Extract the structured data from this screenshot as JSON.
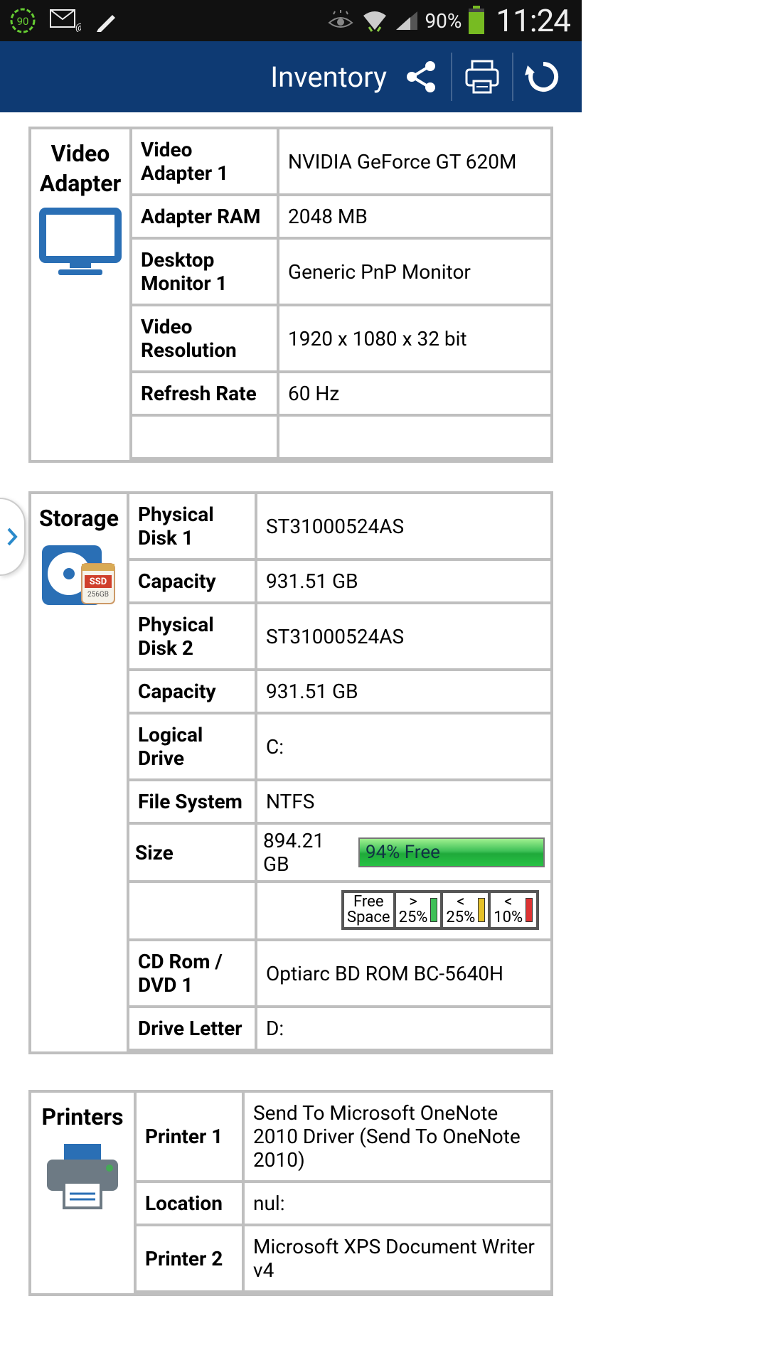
{
  "status": {
    "battery_pct": "90%",
    "time": "11:24"
  },
  "header": {
    "title": "Inventory"
  },
  "video": {
    "title": "Video Adapter",
    "rows": [
      {
        "k": "Video Adapter 1",
        "v": "NVIDIA GeForce GT 620M"
      },
      {
        "k": "Adapter RAM",
        "v": "2048 MB"
      },
      {
        "k": "Desktop Monitor 1",
        "v": "Generic PnP Monitor"
      },
      {
        "k": "Video Resolution",
        "v": "1920 x 1080 x 32 bit"
      },
      {
        "k": "Refresh Rate",
        "v": "60 Hz"
      }
    ]
  },
  "storage": {
    "title": "Storage",
    "rows_top": [
      {
        "k": "Physical Disk 1",
        "v": "ST31000524AS"
      },
      {
        "k": "Capacity",
        "v": "931.51 GB"
      },
      {
        "k": "Physical Disk 2",
        "v": "ST31000524AS"
      },
      {
        "k": "Capacity",
        "v": "931.51 GB"
      },
      {
        "k": "Logical Drive",
        "v": "C:"
      },
      {
        "k": "File System",
        "v": "NTFS"
      }
    ],
    "size_label": "Size",
    "size_value": "894.21 GB",
    "free_pct_label": "94% Free",
    "legend": {
      "c0": {
        "l1": "Free",
        "l2": "Space"
      },
      "c1": {
        "l1": ">",
        "l2": "25%"
      },
      "c2": {
        "l1": "<",
        "l2": "25%"
      },
      "c3": {
        "l1": "<",
        "l2": "10%"
      }
    },
    "rows_bottom": [
      {
        "k": "CD Rom / DVD 1",
        "v": "Optiarc BD ROM BC-5640H"
      },
      {
        "k": "Drive Letter",
        "v": "D:"
      }
    ]
  },
  "printers": {
    "title": "Printers",
    "rows": [
      {
        "k": "Printer 1",
        "v": "Send To Microsoft OneNote 2010 Driver (Send To OneNote 2010)"
      },
      {
        "k": "Location",
        "v": "nul:"
      },
      {
        "k": "Printer 2",
        "v": "Microsoft XPS Document Writer v4"
      }
    ]
  }
}
